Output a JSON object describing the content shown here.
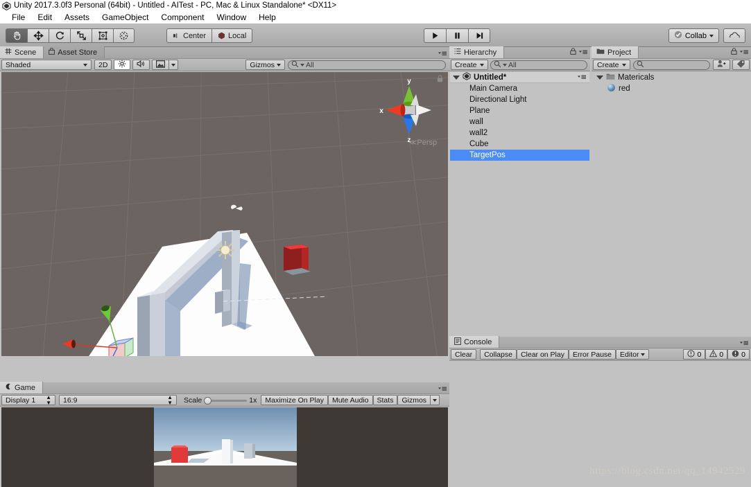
{
  "window": {
    "title": "Unity 2017.3.0f3 Personal (64bit) - Untitled - AITest - PC, Mac & Linux Standalone* <DX11>",
    "logo_icon": "unity-logo-icon"
  },
  "menubar": {
    "items": [
      {
        "label": "File"
      },
      {
        "label": "Edit"
      },
      {
        "label": "Assets"
      },
      {
        "label": "GameObject"
      },
      {
        "label": "Component"
      },
      {
        "label": "Window"
      },
      {
        "label": "Help"
      }
    ]
  },
  "toolbar": {
    "transform_tools": [
      {
        "name": "hand-tool",
        "icon": "hand-icon",
        "active": true
      },
      {
        "name": "move-tool",
        "icon": "move-arrows-icon",
        "active": false
      },
      {
        "name": "rotate-tool",
        "icon": "rotate-icon",
        "active": false
      },
      {
        "name": "scale-tool",
        "icon": "scale-icon",
        "active": false
      },
      {
        "name": "rect-tool",
        "icon": "rect-transform-icon",
        "active": false
      },
      {
        "name": "transform-tool",
        "icon": "transform-icon",
        "active": false
      }
    ],
    "pivot_label": "Center",
    "pivot_icon": "pivot-center-icon",
    "handle_label": "Local",
    "handle_icon": "handle-local-icon",
    "play_label": "▶",
    "pause_label": "❘❘",
    "step_label": "▶❘",
    "collab_label": "Collab",
    "collab_icon": "collab-check-icon",
    "cloud_icon": "cloud-icon",
    "account_caret": "▾"
  },
  "scene": {
    "tabs": [
      {
        "label": "Scene",
        "icon": "scene-grid-icon",
        "active": true
      },
      {
        "label": "Asset Store",
        "icon": "asset-store-icon",
        "active": false
      }
    ],
    "draw_mode": "Shaded",
    "mode_2d": "2D",
    "lighting_icon": "lighting-sun-icon",
    "audio_icon": "audio-speaker-icon",
    "fx_icon": "effects-image-icon",
    "gizmos_label": "Gizmos",
    "search_placeholder": "All",
    "search_value": "All",
    "search_icon": "search-icon",
    "gizmo_axis": {
      "x": "x",
      "y": "y",
      "z": "z",
      "projection": "Persp",
      "projection_prefix": "≪"
    },
    "lock_icon": "lock-icon",
    "menu_icon": "panel-menu-icon"
  },
  "hierarchy": {
    "tab_label": "Hierarchy",
    "tab_icon": "hierarchy-icon",
    "create_label": "Create",
    "search_placeholder": "All",
    "search_value": "All",
    "scene_name": "Untitled*",
    "scene_icon": "unity-scene-icon",
    "items": [
      {
        "label": "Main Camera",
        "selected": false
      },
      {
        "label": "Directional Light",
        "selected": false
      },
      {
        "label": "Plane",
        "selected": false
      },
      {
        "label": "wall",
        "selected": false
      },
      {
        "label": "wall2",
        "selected": false
      },
      {
        "label": "Cube",
        "selected": false
      },
      {
        "label": "TargetPos",
        "selected": true
      }
    ]
  },
  "project": {
    "tab_label": "Project",
    "tab_icon": "folder-icon",
    "create_label": "Create",
    "search_placeholder": "",
    "search_value": "",
    "filter_type_icon": "filter-by-type-icon",
    "filter_label_icon": "filter-by-label-icon",
    "tree": [
      {
        "label": "Matericals",
        "icon": "folder-icon",
        "depth": 0,
        "expanded": true
      },
      {
        "label": "red",
        "icon": "material-sphere-icon",
        "depth": 1
      }
    ]
  },
  "console": {
    "tab_label": "Console",
    "tab_icon": "console-icon",
    "buttons": [
      {
        "label": "Clear"
      },
      {
        "label": "Collapse"
      },
      {
        "label": "Clear on Play"
      },
      {
        "label": "Error Pause"
      },
      {
        "label": "Editor"
      }
    ],
    "counters": [
      {
        "icon": "info-icon",
        "count": "0"
      },
      {
        "icon": "warning-icon",
        "count": "0"
      },
      {
        "icon": "error-icon",
        "count": "0"
      }
    ]
  },
  "game": {
    "tab_label": "Game",
    "tab_icon": "game-icon",
    "display_label": "Display 1",
    "aspect_label": "16:9",
    "scale_label": "Scale",
    "scale_value": "1x",
    "maximize_label": "Maximize On Play",
    "mute_label": "Mute Audio",
    "stats_label": "Stats",
    "gizmos_label": "Gizmos"
  },
  "watermark": "https://blog.csdn.net/qq_14942529",
  "colors": {
    "selection_blue": "#4b8bf4",
    "scene_bg": "#6b6460",
    "cube_red": "#e03a3a",
    "panel_bg": "#c2c2c2",
    "toolbar_bg": "#b4b4b4"
  }
}
